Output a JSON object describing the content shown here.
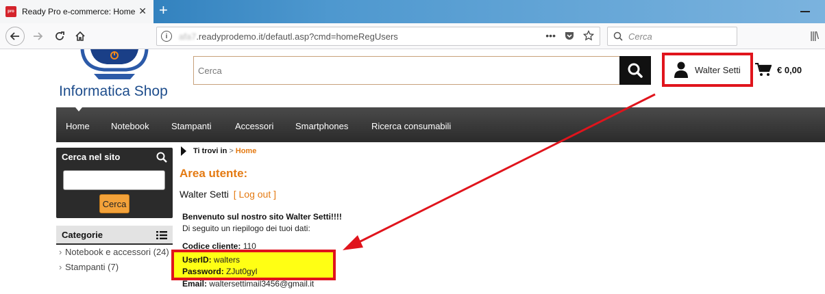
{
  "browser": {
    "tab_title": "Ready Pro e-commerce: Home",
    "favicon_text": "pro",
    "url_blurred": "afa7",
    "url_rest": ".readyprodemo.it/defautl.asp?cmd=homeRegUsers",
    "search_placeholder": "Cerca"
  },
  "header": {
    "logo_text": "Informatica Shop",
    "search_placeholder": "Cerca",
    "user_name": "Walter Setti",
    "cart_total": "€ 0,00"
  },
  "menu": {
    "items": [
      "Home",
      "Notebook",
      "Stampanti",
      "Accessori",
      "Smartphones",
      "Ricerca consumabili"
    ]
  },
  "sidebar": {
    "search_title": "Cerca nel sito",
    "search_button": "Cerca",
    "categories_title": "Categorie",
    "categories": [
      "Notebook e accessori (24)",
      "Stampanti (7)"
    ]
  },
  "main": {
    "breadcrumb_label": "Ti trovi in",
    "breadcrumb_sep": ">",
    "breadcrumb_home": "Home",
    "area_title": "Area utente:",
    "user_name": "Walter Setti",
    "logout": "[ Log out ]",
    "welcome": "Benvenuto sul nostro sito Walter Setti!!!!",
    "summary": "Di seguito un riepilogo dei tuoi dati:",
    "fields": [
      {
        "label": "Codice cliente:",
        "value": "110"
      },
      {
        "label": "UserID:",
        "value": "walters"
      },
      {
        "label": "Password:",
        "value": "ZJut0gyl"
      },
      {
        "label": "Email:",
        "value": "waltersettimail3456@gmail.it"
      }
    ]
  },
  "colors": {
    "accent_orange": "#e47a12",
    "highlight_red": "#e0141c",
    "highlight_yellow": "#ffff14",
    "menu_dark": "#2b2b2b"
  }
}
